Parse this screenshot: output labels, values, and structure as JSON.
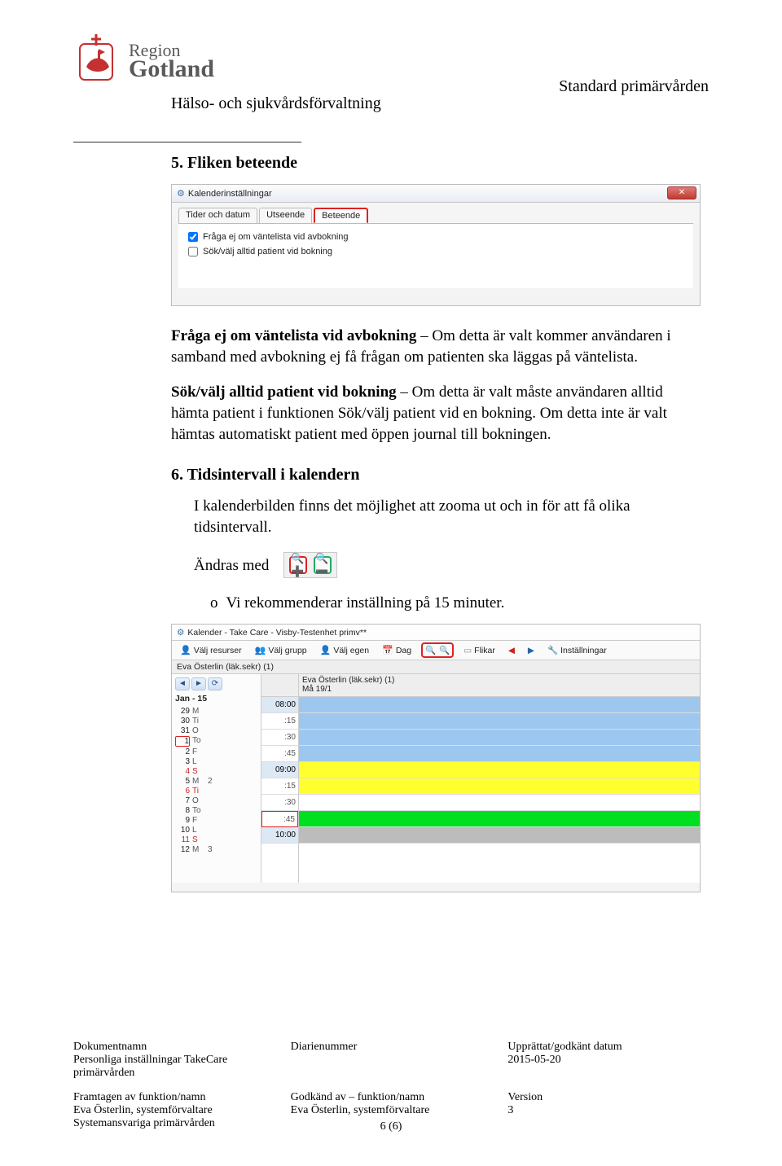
{
  "header": {
    "logo_line1": "Region",
    "logo_line2": "Gotland",
    "doc_type": "Standard primärvården",
    "department": "Hälso- och sjukvårdsförvaltning"
  },
  "section5": {
    "num_title": "5.  Fliken beteende",
    "ss1": {
      "window_title": "Kalenderinställningar",
      "tab1": "Tider och datum",
      "tab2": "Utseende",
      "tab3": "Beteende",
      "chk1_label": "Fråga ej om väntelista vid avbokning",
      "chk2_label": "Sök/välj alltid patient vid bokning",
      "chk1_checked": true,
      "chk2_checked": false
    },
    "p1_b": "Fråga ej om väntelista vid avbokning",
    "p1_rest": " – Om detta är valt kommer användaren i samband med avbokning ej få frågan om patienten ska läggas på väntelista.",
    "p2_b": "Sök/välj alltid patient vid bokning",
    "p2_rest": " – Om detta är valt måste användaren alltid hämta patient i funktionen Sök/välj patient vid en bokning. Om detta inte är valt hämtas automatiskt patient med öppen journal till bokningen."
  },
  "section6": {
    "num_title": "6.  Tidsintervall i kalendern",
    "p1": "I kalenderbilden finns det möjlighet att zooma ut och in för att få olika tidsintervall.",
    "andras": "Ändras med",
    "bullet_o": "o",
    "bullet_text": "Vi rekommenderar inställning på 15 minuter.",
    "ss2": {
      "window_title": "Kalender - Take Care - Visby-Testenhet primv**",
      "tb_valj_resurser": "Välj resurser",
      "tb_valj_grupp": "Välj grupp",
      "tb_valj_egen": "Välj egen",
      "tb_dag": "Dag",
      "tb_flikar": "Flikar",
      "tb_installningar": "Inställningar",
      "resource_label": "Eva Österlin (läk.sekr) (1)",
      "col_header": "Eva Österlin (läk.sekr) (1)",
      "col_sub": "Må 19/1",
      "month": "Jan - 15",
      "days": [
        {
          "n": "29",
          "dow": "M",
          "wk": ""
        },
        {
          "n": "30",
          "dow": "Ti",
          "wk": ""
        },
        {
          "n": "31",
          "dow": "O",
          "wk": ""
        },
        {
          "n": "1",
          "dow": "To",
          "wk": "",
          "today": true
        },
        {
          "n": "2",
          "dow": "F",
          "wk": ""
        },
        {
          "n": "3",
          "dow": "L",
          "wk": ""
        },
        {
          "n": "4",
          "dow": "S",
          "wk": "",
          "sun": true
        },
        {
          "n": "5",
          "dow": "M",
          "wk": "2"
        },
        {
          "n": "6",
          "dow": "Ti",
          "wk": "",
          "sun": true
        },
        {
          "n": "7",
          "dow": "O",
          "wk": ""
        },
        {
          "n": "8",
          "dow": "To",
          "wk": ""
        },
        {
          "n": "9",
          "dow": "F",
          "wk": ""
        },
        {
          "n": "10",
          "dow": "L",
          "wk": ""
        },
        {
          "n": "11",
          "dow": "S",
          "wk": "",
          "sun": true
        },
        {
          "n": "12",
          "dow": "M",
          "wk": "3"
        }
      ],
      "time_slots": [
        "08:00",
        ":15",
        ":30",
        ":45",
        "09:00",
        ":15",
        ":30",
        ":45",
        "10:00"
      ],
      "slot_colors": [
        "blue",
        "blue",
        "blue",
        "blue",
        "yellow",
        "yellow",
        "",
        "green",
        "grey"
      ]
    }
  },
  "footer": {
    "c1_label": "Dokumentnamn",
    "c1_val": "Personliga inställningar TakeCare primärvården",
    "c2_label": "Diarienummer",
    "c2_val": "",
    "c3_label": "Upprättat/godkänt datum",
    "c3_val": "2015-05-20",
    "r2c1_label": "Framtagen av funktion/namn",
    "r2c1_val1": "Eva Österlin, systemförvaltare",
    "r2c1_val2": "Systemansvariga primärvården",
    "r2c2_label": "Godkänd av – funktion/namn",
    "r2c2_val": "Eva Österlin, systemförvaltare",
    "r2c3_label": "Version",
    "r2c3_val": "3",
    "page": "6 (6)"
  }
}
